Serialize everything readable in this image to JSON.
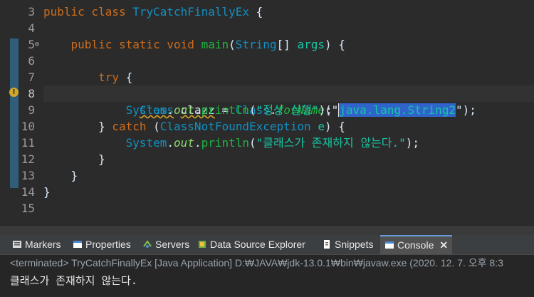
{
  "editor": {
    "line_numbers": [
      "3",
      "4",
      "5",
      "6",
      "7",
      "8",
      "9",
      "10",
      "11",
      "12",
      "13",
      "14",
      "15"
    ],
    "lines": [
      {
        "seg": [
          [
            "kw",
            "public class "
          ],
          [
            "ty",
            "TryCatchFinallyEx"
          ],
          [
            "",
            "{"
          ]
        ]
      },
      {
        "seg": []
      },
      {
        "seg": [
          [
            "",
            "    "
          ],
          [
            "kw",
            "public static void "
          ],
          [
            "fn",
            "main"
          ],
          [
            "",
            "("
          ],
          [
            "ty",
            "String"
          ],
          [
            "",
            "[] "
          ],
          [
            "st",
            "args"
          ],
          [
            "",
            ") {"
          ]
        ]
      },
      {
        "seg": []
      },
      {
        "seg": [
          [
            "",
            "        "
          ],
          [
            "kw",
            "try"
          ],
          [
            "",
            " {"
          ]
        ]
      },
      {
        "seg": []
      },
      {
        "seg": [
          [
            "",
            "            "
          ],
          [
            "ty",
            "System"
          ],
          [
            "",
            "."
          ],
          [
            "field",
            "out"
          ],
          [
            "",
            "."
          ],
          [
            "fn",
            "println"
          ],
          [
            "",
            "("
          ],
          [
            "st",
            "\"정상 실행\""
          ],
          [
            "",
            ");"
          ]
        ]
      },
      {
        "seg": [
          [
            "",
            "        } "
          ],
          [
            "kw",
            "catch"
          ],
          [
            "",
            " ("
          ],
          [
            "ty",
            "ClassNotFoundException"
          ],
          [
            "",
            " "
          ],
          [
            "st",
            "e"
          ],
          [
            "",
            ") {"
          ]
        ]
      },
      {
        "seg": [
          [
            "",
            "            "
          ],
          [
            "ty",
            "System"
          ],
          [
            "",
            "."
          ],
          [
            "field",
            "out"
          ],
          [
            "",
            "."
          ],
          [
            "fn",
            "println"
          ],
          [
            "",
            "("
          ],
          [
            "st",
            "\"클래스가 존재하지 않는다.\""
          ],
          [
            "",
            ");"
          ]
        ]
      },
      {
        "seg": [
          [
            "",
            "        }"
          ]
        ]
      },
      {
        "seg": [
          [
            "",
            "    }"
          ]
        ]
      },
      {
        "seg": [
          [
            "",
            "}"
          ]
        ]
      },
      {
        "seg": []
      }
    ],
    "line8": {
      "type1": "Class",
      "var": "clazz",
      "eq": " = ",
      "type2": "Class",
      "dot": ".",
      "method": "forName",
      "open": "(\"",
      "selected": "java.lang.String2",
      "close": "\");"
    }
  },
  "tabs": [
    {
      "label": "Markers",
      "icon": "markers-icon"
    },
    {
      "label": "Properties",
      "icon": "properties-icon"
    },
    {
      "label": "Servers",
      "icon": "servers-icon"
    },
    {
      "label": "Data Source Explorer",
      "icon": "data-source-icon"
    },
    {
      "label": "Snippets",
      "icon": "snippets-icon"
    },
    {
      "label": "Console",
      "icon": "console-icon",
      "active": true
    }
  ],
  "close_glyph": "✕",
  "console": {
    "status": "<terminated> TryCatchFinallyEx [Java Application] D:₩JAVA₩jdk-13.0.1₩bin₩javaw.exe (2020. 12. 7. 오후 8:3",
    "output": "클래스가 존재하지 않는다."
  },
  "colors": {
    "keyword": "#cc6c1d",
    "type": "#1290c3",
    "string": "#17c6a3",
    "method": "#1eb540",
    "selection": "#2f65ca"
  }
}
